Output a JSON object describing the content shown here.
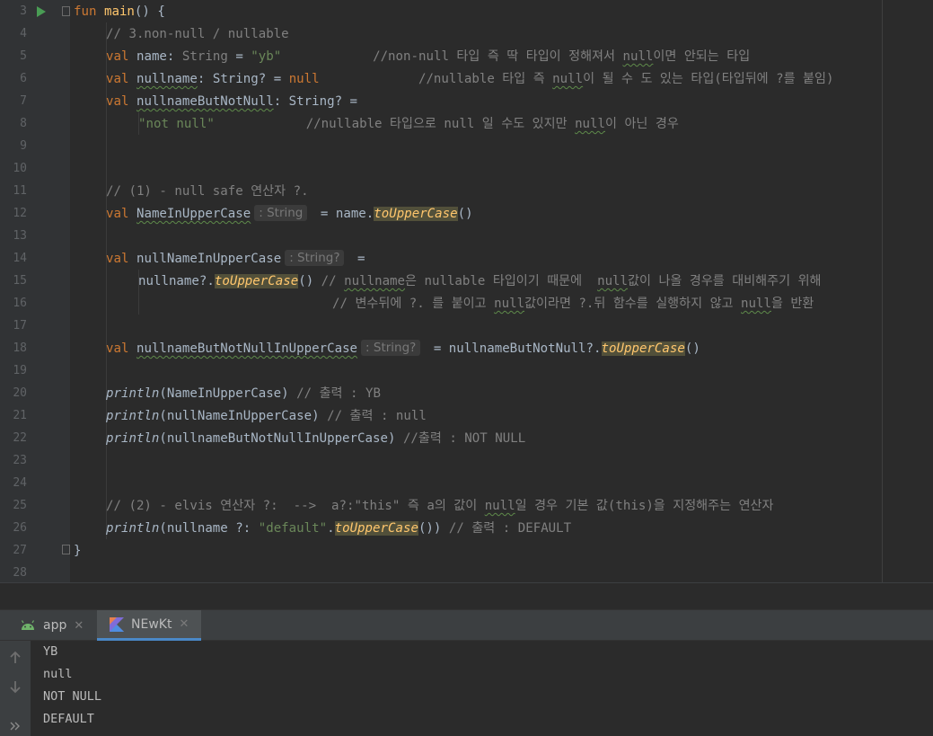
{
  "editor": {
    "line_numbers": [
      "3",
      "4",
      "5",
      "6",
      "7",
      "8",
      "9",
      "10",
      "11",
      "12",
      "13",
      "14",
      "15",
      "16",
      "17",
      "18",
      "19",
      "20",
      "21",
      "22",
      "23",
      "24",
      "25",
      "26",
      "27",
      "28"
    ],
    "code": {
      "l3": {
        "kw": "fun",
        "name": "main",
        "rest": "() {"
      },
      "l4": {
        "comment": "// 3.non-null / nullable"
      },
      "l5": {
        "kw": "val",
        "a": " ",
        "ident": "name",
        "b": ": ",
        "type": "String",
        "c": " = ",
        "str": "\"yb\"",
        "gap": "            ",
        "comment_a": "//non-null 타입 즉 딱 타입이 정해져서 ",
        "comment_null": "null",
        "comment_b": "이면 안되는 타입"
      },
      "l6": {
        "kw": "val",
        "a": " ",
        "ident": "nullname",
        "b": ": String? = ",
        "null": "null",
        "gap": "             ",
        "comment_a": "//nullable 타입 즉 ",
        "comment_null": "null",
        "comment_b": "이 될 수 도 있는 타입(타입뒤에 ?를 붙임)"
      },
      "l7": {
        "kw": "val",
        "a": " ",
        "ident": "nullnameButNotNull",
        "b": ": String? ="
      },
      "l8": {
        "str": "\"not null\"",
        "gap": "            ",
        "comment_a": "//nullable 타입으로 null 일 수도 있지만 ",
        "comment_null": "null",
        "comment_b": "이 아닌 경우"
      },
      "l11": {
        "comment": "// (1) - null safe 연산자 ?."
      },
      "l12": {
        "kw": "val",
        "a": " ",
        "ident": "NameInUpperCase",
        "hint": ": String",
        "b": " = name.",
        "call": "toUpperCase",
        "c": "()"
      },
      "l14": {
        "kw": "val",
        "a": " ",
        "ident": "nullNameInUpperCase",
        "hint": ": String?",
        "b": " ="
      },
      "l15": {
        "a": "nullname?.",
        "call": "toUpperCase",
        "b": "() ",
        "comment_a": "// ",
        "comment_w1": "nullname",
        "comment_b": "은 nullable 타입이기 때문에  ",
        "comment_w2": "null",
        "comment_c": "값이 나올 경우를 대비해주기 위해"
      },
      "l16": {
        "comment_a": "// 변수뒤에 ?. 를 붙이고 ",
        "comment_w1": "null",
        "comment_b": "값이라면 ?.뒤 함수를 실행하지 않고 ",
        "comment_w2": "null",
        "comment_c": "을 반환"
      },
      "l18": {
        "kw": "val",
        "a": " ",
        "ident": "nullnameButNotNullInUpperCase",
        "hint": ": String?",
        "b": " = nullnameButNotNull?.",
        "call": "toUpperCase",
        "c": "()"
      },
      "l20": {
        "fn": "println",
        "a": "(NameInUpperCase) ",
        "comment": "// 출력 : YB"
      },
      "l21": {
        "fn": "println",
        "a": "(nullNameInUpperCase) ",
        "comment": "// 출력 : null"
      },
      "l22": {
        "fn": "println",
        "a": "(nullnameButNotNullInUpperCase) ",
        "comment": "//출력 : NOT NULL"
      },
      "l25": {
        "comment_a": "// (2) - elvis 연산자 ?:  -->  a?:\"this\" 즉 a의 값이 ",
        "comment_w": "null",
        "comment_b": "일 경우 기본 값(this)을 지정해주는 연산자"
      },
      "l26": {
        "fn": "println",
        "a": "(nullname ?: ",
        "str": "\"default\"",
        "b": ".",
        "call": "toUpperCase",
        "c": "()) ",
        "comment": "// 출력 : DEFAULT"
      },
      "l27": {
        "a": "}"
      }
    }
  },
  "run_panel": {
    "tabs": [
      {
        "label": "app",
        "icon": "android-icon"
      },
      {
        "label": "NEwKt",
        "icon": "kotlin-icon"
      }
    ],
    "close_glyph": "✕",
    "console": [
      "YB",
      "null",
      "NOT NULL",
      "DEFAULT"
    ]
  }
}
